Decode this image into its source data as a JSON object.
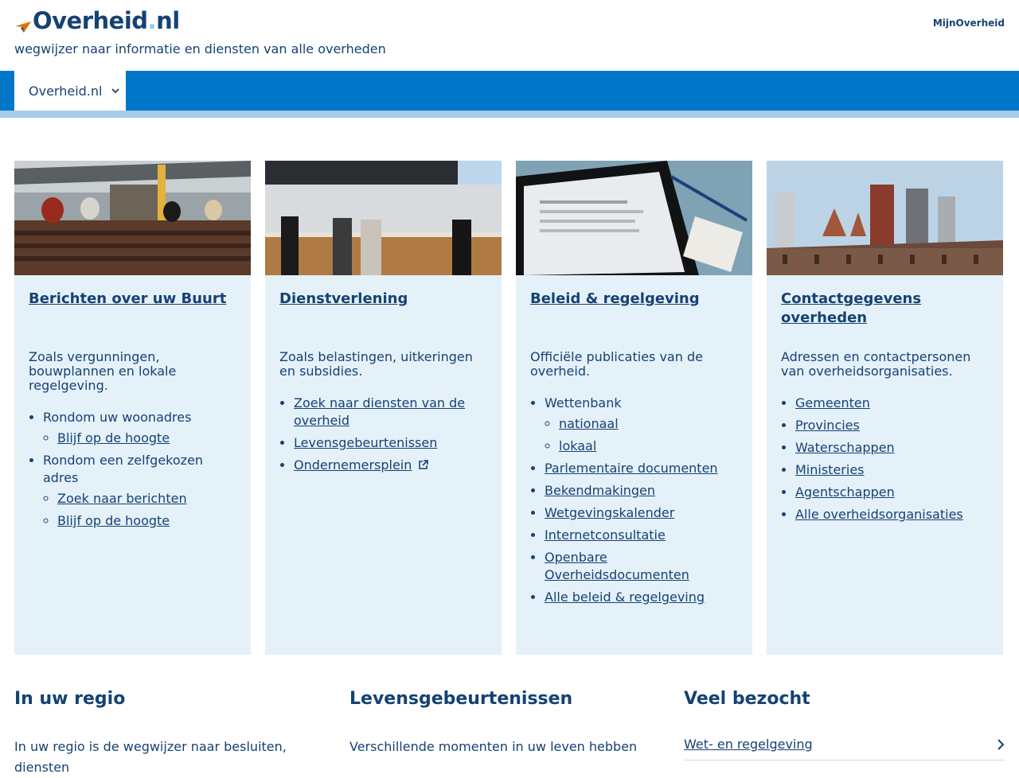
{
  "header": {
    "logo_main": "Overheid",
    "logo_dot": ".",
    "logo_suffix": "nl",
    "tagline": "wegwijzer naar informatie en diensten van alle overheden",
    "mijn_link": "MijnOverheid"
  },
  "nav": {
    "dropdown_label": "Overheid.nl",
    "bar_color": "#0077c8",
    "strip_color": "#a3cde9"
  },
  "cards": [
    {
      "title": "Berichten over uw Buurt",
      "description": "Zoals vergunningen, bouwplannen en lokale regelgeving.",
      "groups": [
        {
          "label": "Rondom uw woonadres",
          "links": [
            "Blijf op de hoogte"
          ]
        },
        {
          "label": "Rondom een zelfgekozen adres",
          "links": [
            "Zoek naar berichten",
            "Blijf op de hoogte"
          ]
        }
      ]
    },
    {
      "title": "Dienstverlening",
      "description": "Zoals belastingen, uitkeringen en subsidies.",
      "links": [
        "Zoek naar diensten van de overheid",
        "Levensgebeurtenissen",
        "Ondernemersplein"
      ]
    },
    {
      "title": "Beleid & regelgeving",
      "description": "Officiële publicaties van de overheid.",
      "group": {
        "label": "Wettenbank",
        "links": [
          "nationaal",
          "lokaal"
        ]
      },
      "links": [
        "Parlementaire documenten",
        "Bekendmakingen",
        "Wetgevingskalender",
        "Internetconsultatie",
        "Openbare Overheidsdocumenten",
        "Alle beleid & regelgeving"
      ]
    },
    {
      "title": "Contactgegevens overheden",
      "description": "Adressen en contactpersonen van overheidsorganisaties.",
      "links": [
        "Gemeenten",
        "Provincies",
        "Waterschappen",
        "Ministeries",
        "Agentschappen",
        "Alle overheidsorganisaties"
      ]
    }
  ],
  "bottom": {
    "regio_title": "In uw regio",
    "regio_text": "In uw regio is de wegwijzer naar besluiten, diensten",
    "leven_title": "Levensgebeurtenissen",
    "leven_text": "Verschillende momenten in uw leven hebben",
    "veel_title": "Veel bezocht",
    "veel_links": [
      "Wet- en regelgeving"
    ]
  }
}
